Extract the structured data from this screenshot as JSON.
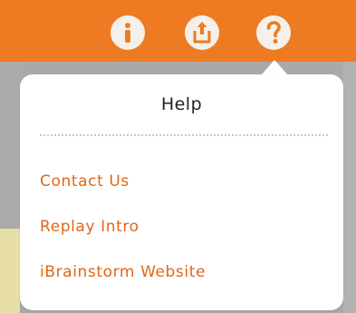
{
  "toolbar": {
    "buttons": [
      {
        "icon": "info-icon"
      },
      {
        "icon": "share-icon"
      },
      {
        "icon": "help-icon"
      }
    ],
    "accent_color": "#ee7b22"
  },
  "help_popover": {
    "title": "Help",
    "items": [
      {
        "label": "Contact Us"
      },
      {
        "label": "Replay Intro"
      },
      {
        "label": "iBrainstorm Website"
      }
    ],
    "item_color": "#e0661a"
  }
}
